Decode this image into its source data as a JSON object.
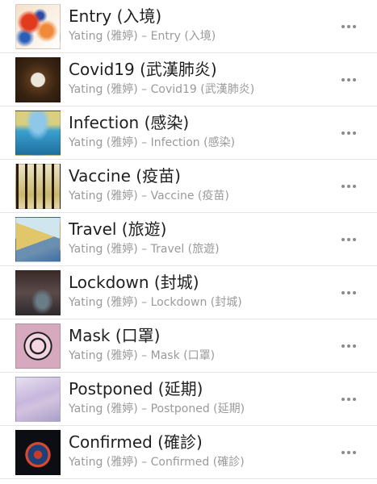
{
  "tracks": [
    {
      "title": "Entry (入境)",
      "subtitle": "Yating (雅婷) – Entry (入境)"
    },
    {
      "title": "Covid19 (武漢肺炎)",
      "subtitle": "Yating (雅婷) – Covid19 (武漢肺炎)"
    },
    {
      "title": "Infection (感染)",
      "subtitle": "Yating (雅婷) – Infection (感染)"
    },
    {
      "title": "Vaccine (疫苗)",
      "subtitle": "Yating (雅婷) – Vaccine (疫苗)"
    },
    {
      "title": "Travel (旅遊)",
      "subtitle": "Yating (雅婷) – Travel (旅遊)"
    },
    {
      "title": "Lockdown (封城)",
      "subtitle": "Yating (雅婷) – Lockdown (封城)"
    },
    {
      "title": "Mask (口罩)",
      "subtitle": "Yating (雅婷) – Mask (口罩)"
    },
    {
      "title": "Postponed (延期)",
      "subtitle": "Yating (雅婷) – Postponed (延期)"
    },
    {
      "title": "Confirmed (確診)",
      "subtitle": "Yating (雅婷) – Confirmed (確診)"
    }
  ],
  "more_icon": "more-horizontal-icon"
}
